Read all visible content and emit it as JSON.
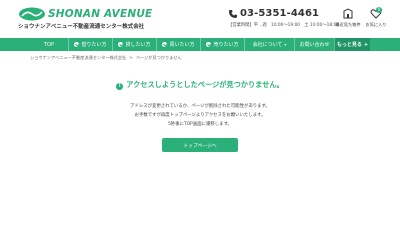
{
  "header": {
    "logo": {
      "main": "SHONAN AVENUE",
      "sub": "ショウナンアベニュー不動産流通センター株式会社"
    },
    "contact": {
      "phone": "03-5351-4461",
      "hours": "【営業時間】平…週　10:00〜19:00　土 10:00〜18:00"
    },
    "actions": [
      {
        "label": "最近見た物件",
        "icon": "history-icon"
      },
      {
        "label": "お気に入り",
        "icon": "heart-icon",
        "badge": "0"
      }
    ]
  },
  "nav": {
    "items": [
      "TOP",
      "借りたい方",
      "貸したい方",
      "買いたい方",
      "売りたい方",
      "会社について",
      "お問い合わせ"
    ],
    "more": "もっと見る",
    "accent": "#2bb07a"
  },
  "breadcrumb": [
    "ショウナンアベニュー不動産流通センター株式会社",
    ">",
    "ページが見つかりません"
  ],
  "main": {
    "title": "アクセスしようとしたページが見つかりません。",
    "lines": [
      "アドレスが変更されているか、ページが削除された可能性があります。",
      "お手数ですが再度トップページよりアクセスをお願いいたします。",
      "5秒後にTOP画面に遷移します。"
    ],
    "button": "トップページへ"
  }
}
